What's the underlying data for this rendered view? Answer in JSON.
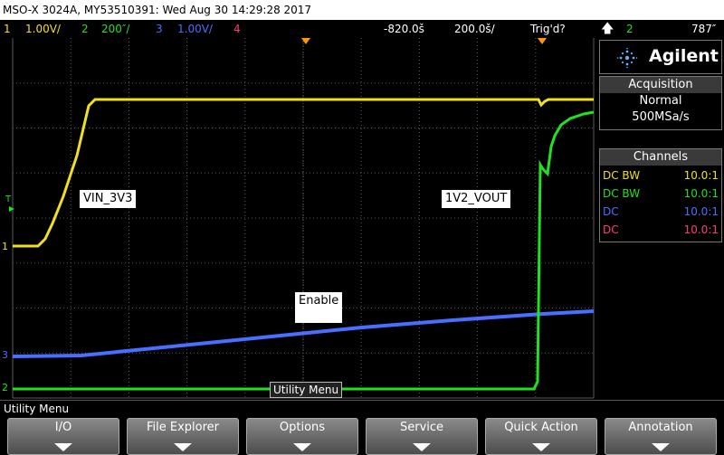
{
  "title_bar": "MSO-X 3024A, MY53510391: Wed Aug 30 14:29:28 2017",
  "status": {
    "ch1_num": "1",
    "ch1_scale": "1.00V/",
    "ch2_num": "2",
    "ch2_scale": "200″/",
    "ch3_num": "3",
    "ch3_scale": "1.00V/",
    "ch4_num": "4",
    "time_offset": "-820.0š",
    "time_scale": "200.0š/",
    "trigger": "Trig'd?",
    "trig_source": "2",
    "trig_level": "787″"
  },
  "colors": {
    "ch1": "#f0e020",
    "ch2": "#22e022",
    "ch3": "#4a6fff",
    "ch4": "#ff3a80",
    "trig": "#ff9a00",
    "grid": "#5a5a5a"
  },
  "screen": {
    "labels": {
      "vin": "VIN_3V3",
      "vout": "1V2_VOUT",
      "enable": "Enable"
    },
    "markers": {
      "ch1": "1",
      "ch2": "2",
      "ch3": "3",
      "trigger_t": "T"
    },
    "overlay_menu": "Utility Menu"
  },
  "panel": {
    "brand": "Agilent",
    "acquisition": {
      "header": "Acquisition",
      "mode": "Normal",
      "rate": "500MSa/s"
    },
    "channels": {
      "header": "Channels",
      "rows": [
        {
          "coupling": "DC BW",
          "ratio": "10.0:1"
        },
        {
          "coupling": "DC BW",
          "ratio": "10.0:1"
        },
        {
          "coupling": "DC",
          "ratio": "10.0:1"
        },
        {
          "coupling": "DC",
          "ratio": "10.0:1"
        }
      ]
    }
  },
  "menu": {
    "label": "Utility Menu",
    "softkeys": [
      "I/O",
      "File Explorer",
      "Options",
      "Service",
      "Quick Action",
      "Annotation"
    ]
  }
}
